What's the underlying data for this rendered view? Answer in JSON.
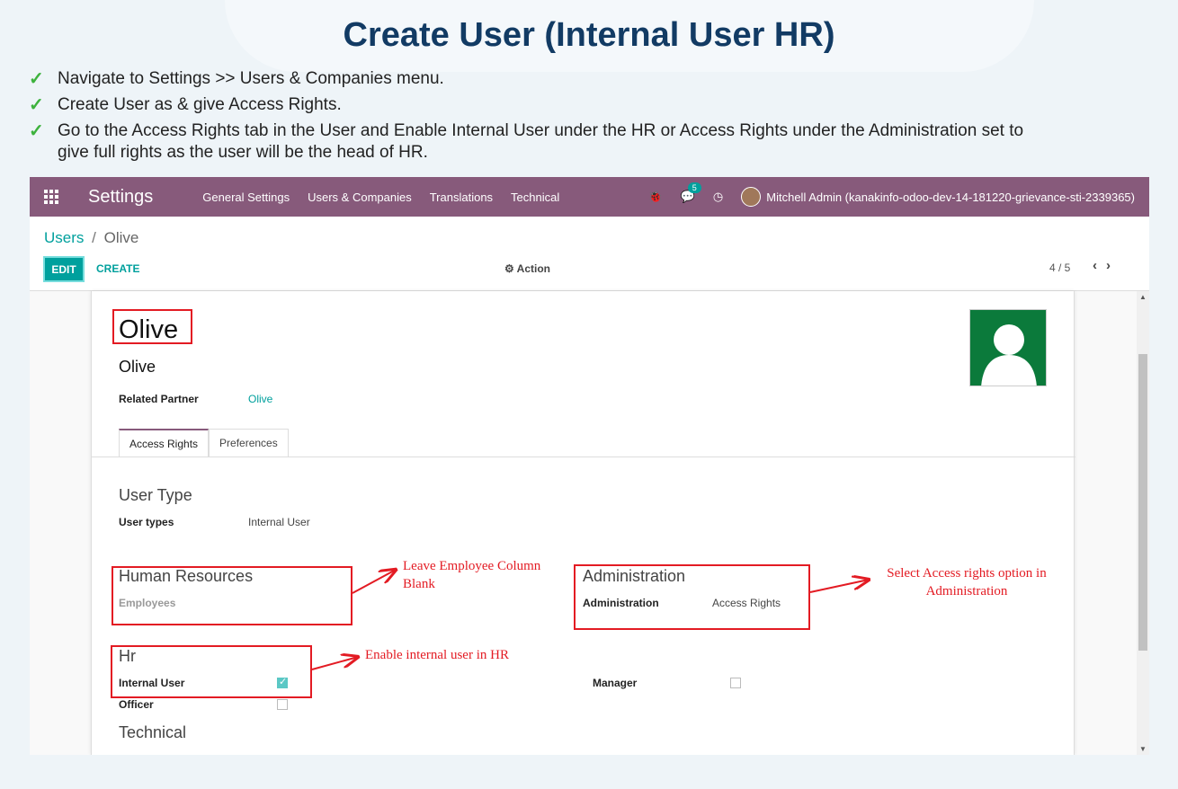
{
  "slide": {
    "title": "Create User (Internal User HR)",
    "bullets": [
      "Navigate to Settings >> Users & Companies menu.",
      "Create User as & give Access Rights.",
      "Go to the Access Rights tab in the User and Enable Internal User under the HR or Access Rights under the Administration set to give full rights as the user will be the head of HR."
    ]
  },
  "topbar": {
    "app_name": "Settings",
    "menu": [
      "General Settings",
      "Users & Companies",
      "Translations",
      "Technical"
    ],
    "bug_icon": "bug-icon",
    "chat_badge": "5",
    "clock_icon": "clock-icon",
    "user": "Mitchell Admin (kanakinfo-odoo-dev-14-181220-grievance-sti-2339365)"
  },
  "control_panel": {
    "breadcrumb_parent": "Users",
    "breadcrumb_sep": "/",
    "breadcrumb_current": "Olive",
    "edit_label": "EDIT",
    "create_label": "CREATE",
    "action_label": "Action",
    "pager": "4 / 5"
  },
  "form": {
    "name": "Olive",
    "login": "Olive",
    "related_partner_label": "Related Partner",
    "related_partner_value": "Olive",
    "tabs": [
      "Access Rights",
      "Preferences"
    ],
    "user_type": {
      "title": "User Type",
      "label": "User types",
      "value": "Internal User"
    },
    "human_resources": {
      "title": "Human Resources",
      "employees_label": "Employees"
    },
    "administration": {
      "title": "Administration",
      "label": "Administration",
      "value": "Access Rights"
    },
    "hr": {
      "title": "Hr",
      "internal_user_label": "Internal User",
      "internal_user_checked": true,
      "officer_label": "Officer",
      "officer_checked": false,
      "manager_label": "Manager",
      "manager_checked": false
    },
    "technical_title": "Technical"
  },
  "annotations": {
    "employee": "Leave Employee Column Blank",
    "administration": "Select Access rights option in Administration",
    "hr": "Enable internal user in HR"
  },
  "colors": {
    "topbar": "#875a7b",
    "accent": "#00a09d",
    "annotation": "#e31b23",
    "title": "#123b64"
  }
}
